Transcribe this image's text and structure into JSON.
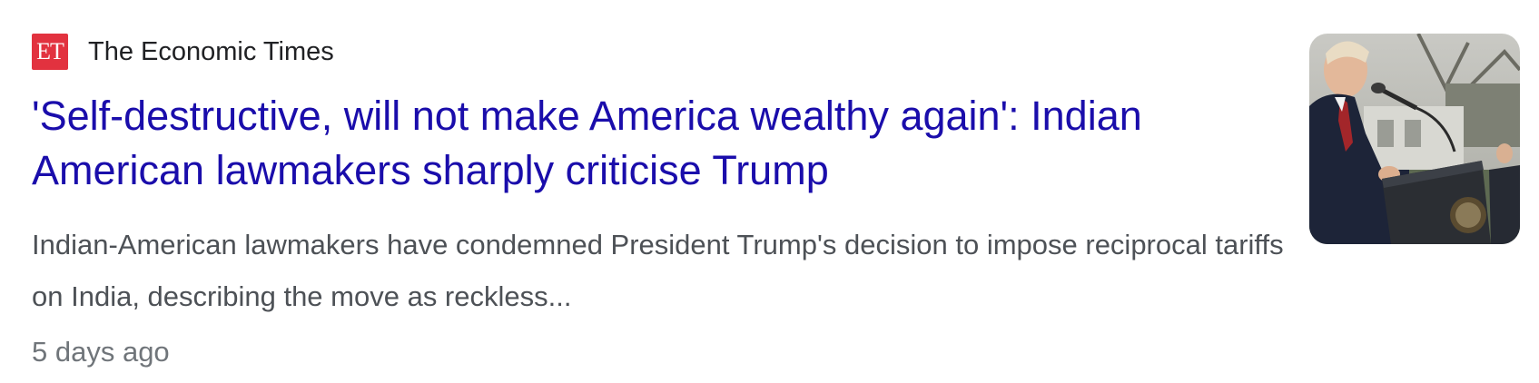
{
  "result": {
    "source": {
      "logo_text": "ET",
      "name": "The Economic Times",
      "logo_color": "#e2323f"
    },
    "headline": "'Self-destructive, will not make America wealthy again': Indian American lawmakers sharply criticise Trump",
    "snippet": "Indian-American lawmakers have condemned President Trump's decision to impose reciprocal tariffs on India, describing the move as reckless...",
    "time": "5 days ago",
    "thumbnail": {
      "icon": "news-photo-speaker-at-podium"
    }
  },
  "colors": {
    "link": "#1a0dab",
    "snippet": "#4d5156",
    "meta": "#70757a"
  }
}
